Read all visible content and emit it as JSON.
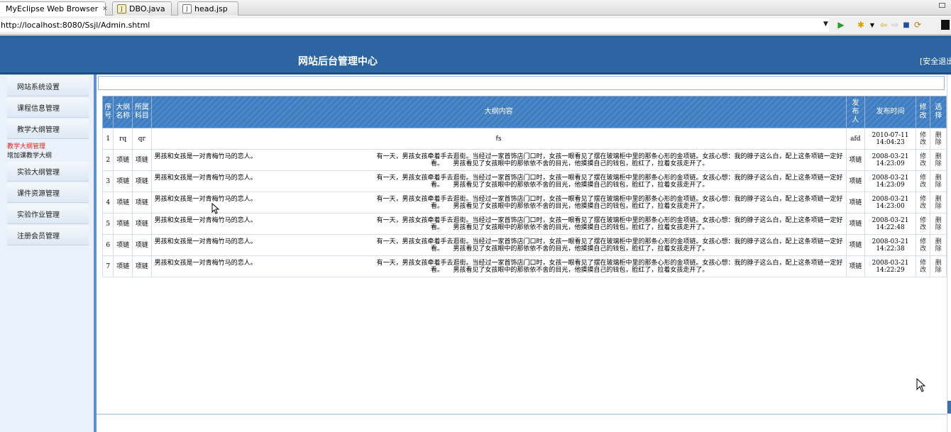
{
  "tabs": [
    {
      "label": "MyEclipse Web Browser",
      "active": true,
      "icon": "globe-icon"
    },
    {
      "label": "DBO.java",
      "active": false,
      "icon": "java-file-icon"
    },
    {
      "label": "head.jsp",
      "active": false,
      "icon": "jsp-file-icon"
    }
  ],
  "browser": {
    "url": "http://localhost:8080/Ssjl/Admin.shtml"
  },
  "header": {
    "title": "网站后台管理中心",
    "logout": "[安全退出"
  },
  "sidebar": {
    "items": [
      "网站系统设置",
      "课程信息管理",
      "教学大纲管理",
      "实验大纲管理",
      "课件资源管理",
      "实验作业管理",
      "注册会员管理"
    ],
    "subitems": [
      "教学大纲管理",
      "增加课教学大纲"
    ]
  },
  "table": {
    "headers": {
      "no": [
        "序",
        "号"
      ],
      "name": [
        "大纲",
        "名称"
      ],
      "subject": [
        "所属",
        "科目"
      ],
      "content": "大纲内容",
      "publisher": [
        "发",
        "布",
        "人"
      ],
      "time": "发布时间",
      "edit": [
        "修",
        "改"
      ],
      "select": [
        "选",
        "择"
      ]
    },
    "rows": [
      {
        "no": "1",
        "name": "rq",
        "subject": "qr",
        "title": "",
        "content": "fs",
        "content2": "",
        "publisher": "afd",
        "date": "2010-07-11",
        "time": "14:04:23",
        "edit": [
          "修",
          "改"
        ],
        "del": [
          "删",
          "除"
        ]
      },
      {
        "no": "2",
        "name": "项链",
        "subject": "项链",
        "title": "男孩和女孩是一对青梅竹马的恋人。",
        "content": "有一天，男孩女孩牵着手去逛街。当经过一家首饰店门口时，女孩一眼看见了摆在玻璃柜中里的那条心形的金项链。女孩心想：我的脖子这么白，配上这条项链一定好",
        "content2": "看。　　男孩看见了女孩眼中的那依依不舍的目光，他摸摸自己的钱包，脸红了，拉着女孩走开了。",
        "publisher": "项链",
        "date": "2008-03-21",
        "time": "14:23:09",
        "edit": [
          "修",
          "改"
        ],
        "del": [
          "删",
          "除"
        ]
      },
      {
        "no": "3",
        "name": "项链",
        "subject": "项链",
        "title": "男孩和女孩是一对青梅竹马的恋人。",
        "content": "有一天，男孩女孩牵着手去逛街。当经过一家首饰店门口时，女孩一眼看见了摆在玻璃柜中里的那条心形的金项链。女孩心想：我的脖子这么白，配上这条项链一定好",
        "content2": "看。　　男孩看见了女孩眼中的那依依不舍的目光，他摸摸自己的钱包，脸红了，拉着女孩走开了。",
        "publisher": "项链",
        "date": "2008-03-21",
        "time": "14:23:09",
        "edit": [
          "修",
          "改"
        ],
        "del": [
          "删",
          "除"
        ]
      },
      {
        "no": "4",
        "name": "项链",
        "subject": "项链",
        "title": "男孩和女孩是一对青梅竹马的恋人。",
        "content": "有一天，男孩女孩牵着手去逛街。当经过一家首饰店门口时，女孩一眼看见了摆在玻璃柜中里的那条心形的金项链。女孩心想：我的脖子这么白，配上这条项链一定好",
        "content2": "看。　　男孩看见了女孩眼中的那依依不舍的目光，他摸摸自己的钱包，脸红了，拉着女孩走开了。",
        "publisher": "项链",
        "date": "2008-03-21",
        "time": "14:23:00",
        "edit": [
          "修",
          "改"
        ],
        "del": [
          "删",
          "除"
        ]
      },
      {
        "no": "5",
        "name": "项链",
        "subject": "项链",
        "title": "男孩和女孩是一对青梅竹马的恋人。",
        "content": "有一天，男孩女孩牵着手去逛街。当经过一家首饰店门口时，女孩一眼看见了摆在玻璃柜中里的那条心形的金项链。女孩心想：我的脖子这么白，配上这条项链一定好",
        "content2": "看。　　男孩看见了女孩眼中的那依依不舍的目光，他摸摸自己的钱包，脸红了，拉着女孩走开了。",
        "publisher": "项链",
        "date": "2008-03-21",
        "time": "14:22:48",
        "edit": [
          "修",
          "改"
        ],
        "del": [
          "删",
          "除"
        ]
      },
      {
        "no": "6",
        "name": "项链",
        "subject": "项链",
        "title": "男孩和女孩是一对青梅竹马的恋人。",
        "content": "有一天，男孩女孩牵着手去逛街。当经过一家首饰店门口时，女孩一眼看见了摆在玻璃柜中里的那条心形的金项链。女孩心想：我的脖子这么白，配上这条项链一定好",
        "content2": "看。　　男孩看见了女孩眼中的那依依不舍的目光，他摸摸自己的钱包，脸红了，拉着女孩走开了。",
        "publisher": "项链",
        "date": "2008-03-21",
        "time": "14:22:38",
        "edit": [
          "修",
          "改"
        ],
        "del": [
          "删",
          "除"
        ]
      },
      {
        "no": "7",
        "name": "项链",
        "subject": "项链",
        "title": "男孩和女孩是一对青梅竹马的恋人。",
        "content": "有一天，男孩女孩牵着手去逛街。当经过一家首饰店门口时，女孩一眼看见了摆在玻璃柜中里的那条心形的金项链。女孩心想：我的脖子这么白，配上这条项链一定好",
        "content2": "看。　　男孩看见了女孩眼中的那依依不舍的目光，他摸摸自己的钱包，脸红了，拉着女孩走开了。",
        "publisher": "项链",
        "date": "2008-03-21",
        "time": "14:22:29",
        "edit": [
          "修",
          "改"
        ],
        "del": [
          "删",
          "除"
        ]
      }
    ]
  },
  "colors": {
    "header_bg": "#2c65a2",
    "sidebar_bg": "#e9f1fa",
    "sidebar_border": "#5d8fd0",
    "sub_item_active": "#e0241c"
  }
}
